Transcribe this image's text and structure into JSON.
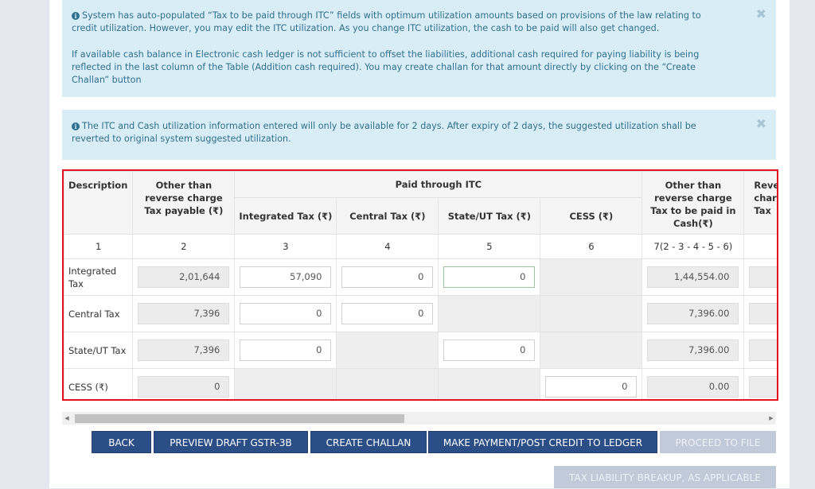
{
  "alerts": {
    "auto_populated": {
      "paragraph1": "System has auto-populated “Tax to be paid through ITC” fields with optimum utilization amounts based on provisions of the law relating to credit utilization. However, you may edit the ITC utilization. As you change ITC utilization, the cash to be paid will also get changed.",
      "paragraph2": "If available cash balance in Electronic cash ledger is not sufficient to offset the liabilities, additional cash required for paying liability is being reflected in the last column of the Table (Addition cash required). You may create challan for that amount directly by clicking on the “Create Challan” button",
      "close": "✖"
    },
    "expiry": {
      "text": "The ITC and Cash utilization information entered will only be available for 2 days. After expiry of 2 days, the suggested utilization shall be reverted to original system suggested utilization.",
      "close": "✖"
    },
    "info_glyph": "i"
  },
  "table": {
    "headers": {
      "description": "Description",
      "tax_payable": "Other than reverse charge Tax payable (₹)",
      "paid_through_itc": "Paid through ITC",
      "integrated": "Integrated Tax (₹)",
      "central": "Central Tax (₹)",
      "state_ut": "State/UT Tax (₹)",
      "cess": "CESS (₹)",
      "cash": "Other than reverse charge Tax to be paid in Cash(₹)",
      "reverse_partial": "Reverse charge Tax"
    },
    "column_numbers": [
      "1",
      "2",
      "3",
      "4",
      "5",
      "6",
      "7(2 - 3 - 4 - 5 - 6)",
      ""
    ],
    "rows": [
      {
        "label": "Integrated Tax",
        "tax_payable": "2,01,644",
        "itc_integrated": "57,090",
        "itc_central": "0",
        "itc_state_ut": "0",
        "cash": "1,44,554.00",
        "reverse": ""
      },
      {
        "label": "Central Tax",
        "tax_payable": "7,396",
        "itc_integrated": "0",
        "itc_central": "0",
        "cash": "7,396.00",
        "reverse": ""
      },
      {
        "label": "State/UT Tax",
        "tax_payable": "7,396",
        "itc_integrated": "0",
        "itc_state_ut": "0",
        "cash": "7,396.00",
        "reverse": ""
      },
      {
        "label": "CESS (₹)",
        "tax_payable": "0",
        "itc_cess": "0",
        "cash": "0.00",
        "reverse": ""
      }
    ]
  },
  "scrollbar": {
    "left_arrow": "◀",
    "right_arrow": "▶"
  },
  "buttons": {
    "back": "BACK",
    "preview": "PREVIEW DRAFT GSTR-3B",
    "create_challan": "CREATE CHALLAN",
    "make_payment": "MAKE PAYMENT/POST CREDIT TO LEDGER",
    "proceed_to_file": "PROCEED TO FILE",
    "tax_liability_breakup": "TAX LIABILITY BREAKUP, AS APPLICABLE"
  },
  "colors": {
    "primary_button": "#2c4e86",
    "disabled_button": "#c0cad9",
    "alert_bg": "#d9edf7",
    "alert_text": "#31708f",
    "highlight_border": "#e0141e"
  }
}
